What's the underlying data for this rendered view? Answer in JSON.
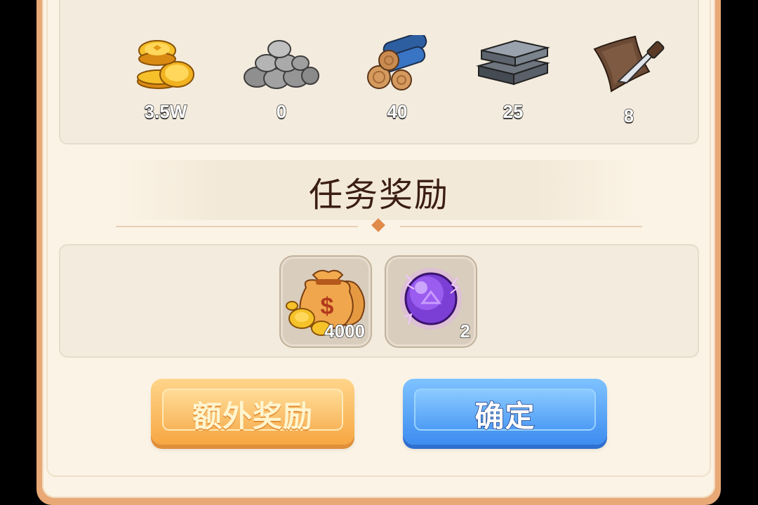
{
  "resources": [
    {
      "icon": "gold-coins-icon",
      "count": "3.5W"
    },
    {
      "icon": "stone-pile-icon",
      "count": "0"
    },
    {
      "icon": "wood-logs-icon",
      "count": "40"
    },
    {
      "icon": "iron-ingots-icon",
      "count": "25"
    },
    {
      "icon": "leather-knife-icon",
      "count": "8"
    }
  ],
  "section_title": "任务奖励",
  "rewards": [
    {
      "icon": "money-bag-icon",
      "count": "4000"
    },
    {
      "icon": "purple-orb-icon",
      "count": "2"
    }
  ],
  "buttons": {
    "extra_reward": "额外奖励",
    "confirm": "确定"
  },
  "colors": {
    "panel": "#fbf3e5",
    "frame": "#e8a977",
    "title": "#3b1e14",
    "extra_button": "#f7a743",
    "confirm_button": "#3d8df0"
  }
}
